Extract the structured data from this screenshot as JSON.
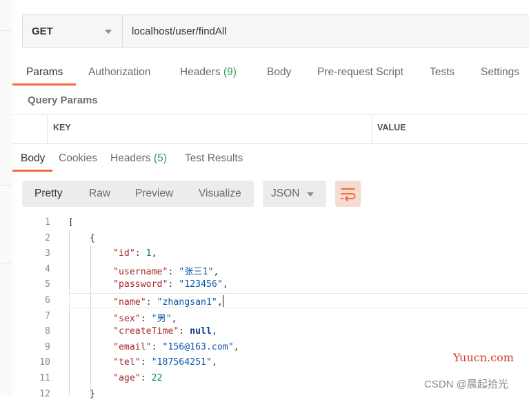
{
  "request": {
    "method": "GET",
    "url": "localhost/user/findAll"
  },
  "request_tabs": [
    {
      "label": "Params",
      "count": ""
    },
    {
      "label": "Authorization",
      "count": ""
    },
    {
      "label": "Headers",
      "count": "(9)"
    },
    {
      "label": "Body",
      "count": ""
    },
    {
      "label": "Pre-request Script",
      "count": ""
    },
    {
      "label": "Tests",
      "count": ""
    },
    {
      "label": "Settings",
      "count": ""
    }
  ],
  "query_params": {
    "title": "Query Params",
    "columns": [
      "KEY",
      "VALUE"
    ]
  },
  "response_tabs": [
    {
      "label": "Body",
      "count": ""
    },
    {
      "label": "Cookies",
      "count": ""
    },
    {
      "label": "Headers",
      "count": "(5)"
    },
    {
      "label": "Test Results",
      "count": ""
    }
  ],
  "view_modes": [
    "Pretty",
    "Raw",
    "Preview",
    "Visualize"
  ],
  "format": "JSON",
  "icons": {
    "format_select": "chevron-down-icon",
    "wrap": "wrap-lines-icon"
  },
  "colors": {
    "accent": "#f26b3a",
    "count": "#2a9d54"
  },
  "code": {
    "line_numbers": [
      "1",
      "2",
      "3",
      "4",
      "5",
      "6",
      "7",
      "8",
      "9",
      "10",
      "11",
      "12"
    ],
    "open_bracket": "[",
    "open_brace": "{",
    "close_brace": "}",
    "fields": [
      {
        "key": "\"id\"",
        "value": "1",
        "kind": "n",
        "comma": ","
      },
      {
        "key": "\"username\"",
        "value": "\"张三1\"",
        "kind": "s",
        "comma": ","
      },
      {
        "key": "\"password\"",
        "value": "\"123456\"",
        "kind": "s",
        "comma": ","
      },
      {
        "key": "\"name\"",
        "value": "\"zhangsan1\"",
        "kind": "s",
        "comma": ","
      },
      {
        "key": "\"sex\"",
        "value": "\"男\"",
        "kind": "s",
        "comma": ","
      },
      {
        "key": "\"createTime\"",
        "value": "null",
        "kind": "kw",
        "comma": ","
      },
      {
        "key": "\"email\"",
        "value": "\"156@163.com\"",
        "kind": "s",
        "comma": ","
      },
      {
        "key": "\"tel\"",
        "value": "\"187564251\"",
        "kind": "s",
        "comma": ","
      },
      {
        "key": "\"age\"",
        "value": "22",
        "kind": "n",
        "comma": ""
      }
    ]
  },
  "watermarks": {
    "site": "Yuucn.com",
    "author": "CSDN @晨起拾光"
  }
}
